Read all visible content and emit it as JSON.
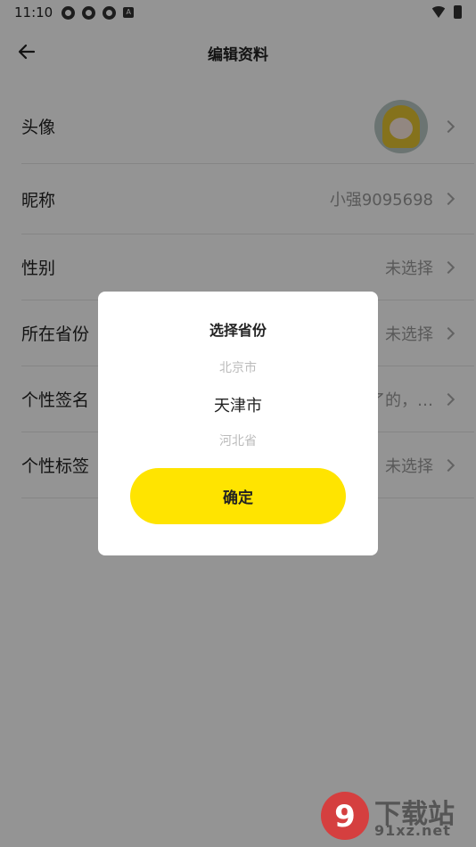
{
  "status_bar": {
    "time": "11:10",
    "a_badge": "A"
  },
  "header": {
    "title": "编辑资料"
  },
  "rows": [
    {
      "label": "头像",
      "value": ""
    },
    {
      "label": "昵称",
      "value": "小强9095698"
    },
    {
      "label": "性别",
      "value": "未选择"
    },
    {
      "label": "所在省份",
      "value": "未选择"
    },
    {
      "label": "个性签名",
      "value": "了的，…"
    },
    {
      "label": "个性标签",
      "value": "未选择"
    }
  ],
  "dialog": {
    "title": "选择省份",
    "options": [
      "北京市",
      "天津市",
      "河北省"
    ],
    "selected": "天津市",
    "confirm_label": "确定"
  },
  "watermark": {
    "brand": "下载站",
    "domain": "91xz.net",
    "logo_text": "9"
  }
}
